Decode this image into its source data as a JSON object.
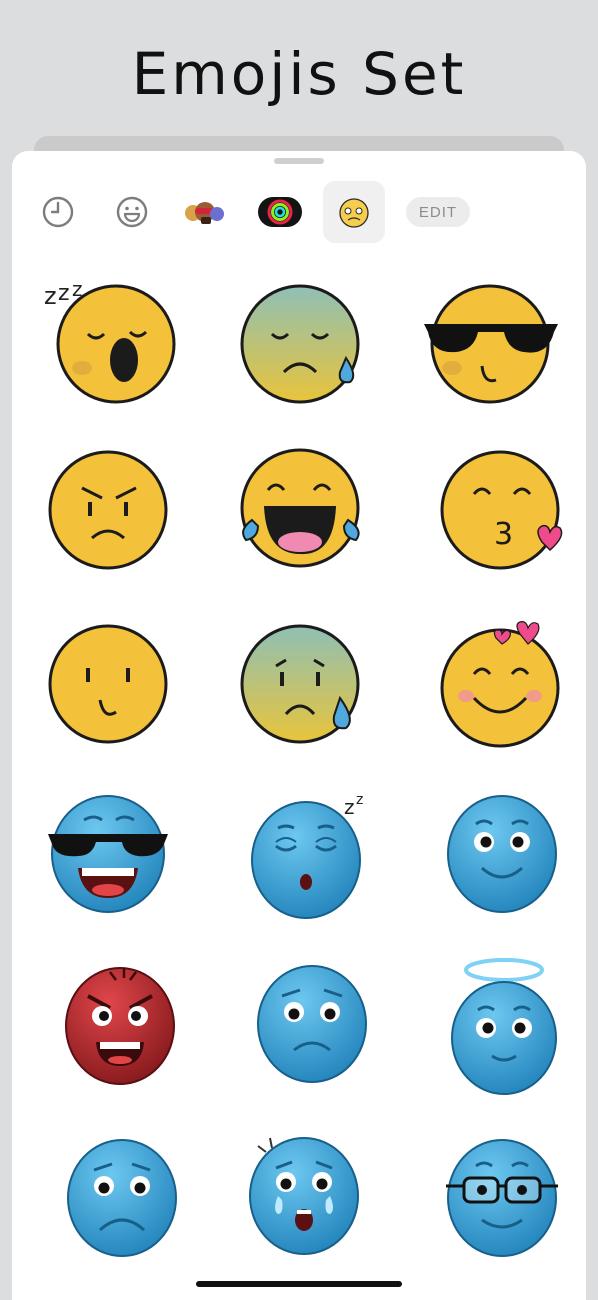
{
  "app": {
    "title": "Emojis Set"
  },
  "toolbar": {
    "tabs": [
      {
        "name": "recent",
        "icon": "clock-icon"
      },
      {
        "name": "smileys",
        "icon": "smiley-icon"
      },
      {
        "name": "memoji",
        "icon": "memoji-stickers-icon"
      },
      {
        "name": "activity",
        "icon": "activity-rings-icon"
      },
      {
        "name": "emojis-set",
        "icon": "emoji-sticker-pack-icon",
        "selected": true
      }
    ],
    "edit_label": "EDIT"
  },
  "stickers": [
    {
      "name": "yellow-yawning-sleepy"
    },
    {
      "name": "yellow-sad-sweat"
    },
    {
      "name": "yellow-sunglasses-cool"
    },
    {
      "name": "yellow-angry"
    },
    {
      "name": "yellow-laughing-tears"
    },
    {
      "name": "yellow-kiss-heart"
    },
    {
      "name": "yellow-simple-smile"
    },
    {
      "name": "yellow-sad-tear"
    },
    {
      "name": "yellow-love-hearts"
    },
    {
      "name": "blue-sunglasses-grin"
    },
    {
      "name": "blue-sleeping"
    },
    {
      "name": "blue-smile"
    },
    {
      "name": "red-angry"
    },
    {
      "name": "blue-worried"
    },
    {
      "name": "blue-angel-halo"
    },
    {
      "name": "blue-frown"
    },
    {
      "name": "blue-crying"
    },
    {
      "name": "blue-glasses-nerd"
    }
  ],
  "colors": {
    "yellow": "#f3c13a",
    "greenish": "#9ec27a",
    "blue": "#2b9bd6",
    "red": "#b3232a",
    "outline": "#1b1b1b"
  }
}
